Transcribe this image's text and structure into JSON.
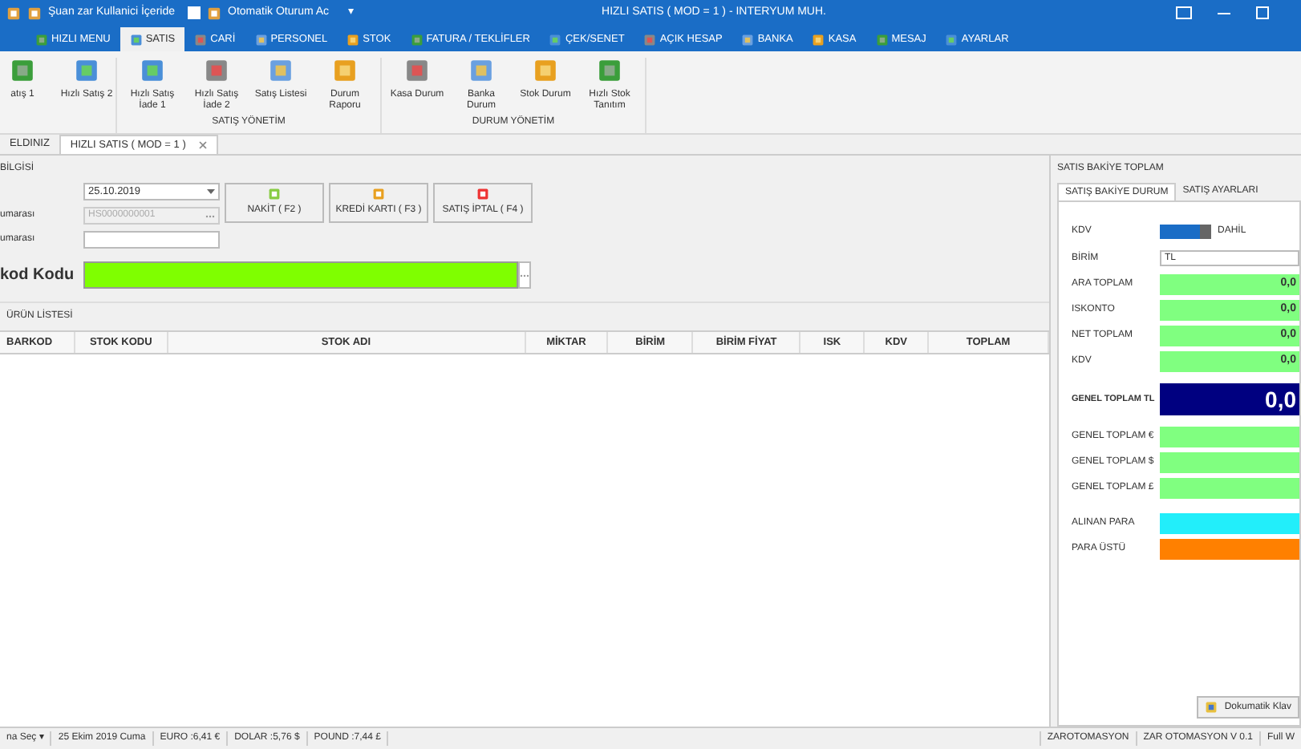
{
  "title_bar": {
    "user": "Şuan zar Kullanici İçeride",
    "auto_login": {
      "label": "Otomatik Oturum Ac",
      "checked": false
    },
    "dropdown": "▾",
    "title": "HIZLI SATIS ( MOD = 1 ) - INTERYUM MUH."
  },
  "menu_tabs": [
    {
      "label": "HIZLI MENU",
      "selected": false
    },
    {
      "label": "SATIS",
      "selected": true
    },
    {
      "label": "CARİ",
      "selected": false
    },
    {
      "label": "PERSONEL",
      "selected": false
    },
    {
      "label": "STOK",
      "selected": false
    },
    {
      "label": "FATURA / TEKLİFLER",
      "selected": false
    },
    {
      "label": "ÇEK/SENET",
      "selected": false
    },
    {
      "label": "AÇIK HESAP",
      "selected": false
    },
    {
      "label": "BANKA",
      "selected": false
    },
    {
      "label": "KASA",
      "selected": false
    },
    {
      "label": "MESAJ",
      "selected": false
    },
    {
      "label": "AYARLAR",
      "selected": false
    }
  ],
  "ribbon": [
    {
      "items": [
        "atış 1",
        "Hızlı Satış 2"
      ]
    },
    {
      "label": "SATIŞ YÖNETİM",
      "items": [
        "Hızlı Satış İade 1",
        "Hızlı Satış İade 2",
        "Satış Listesi",
        "Durum Raporu"
      ]
    },
    {
      "label": "DURUM YÖNETİM",
      "items": [
        "Kasa Durum",
        "Banka Durum",
        "Stok Durum",
        "Hızlı Stok Tanıtım"
      ]
    }
  ],
  "doc_tabs": [
    {
      "label": "ELDINIZ",
      "selected": false,
      "closable": false
    },
    {
      "label": "HIZLI SATIS ( MOD = 1 )",
      "selected": true,
      "closable": true
    }
  ],
  "info": {
    "title": "BİLGİSİ",
    "date": "25.10.2019",
    "number_label": "umarası",
    "number_value": "HS0000000001",
    "number2_label": "umarası",
    "barcode_label": "kod Kodu"
  },
  "actions": [
    "NAKİT  ( F2 )",
    "KREDİ KARTI ( F3 )",
    "SATIŞ İPTAL ( F4 )"
  ],
  "product_list": {
    "title": "ÜRÜN LİSTESİ",
    "columns": [
      "BARKOD",
      "STOK KODU",
      "STOK ADI",
      "MİKTAR",
      "BİRİM",
      "BİRİM FİYAT",
      "ISK",
      "KDV",
      "TOPLAM"
    ]
  },
  "totals": {
    "title": "SATIS BAKİYE TOPLAM",
    "tabs": [
      {
        "label": "SATIŞ BAKİYE DURUM",
        "selected": true
      },
      {
        "label": "SATIŞ AYARLARI",
        "selected": false
      }
    ],
    "kdv": {
      "label": "KDV",
      "on": true,
      "text": "DAHİL"
    },
    "unit": {
      "label": "BİRİM",
      "value": "TL"
    },
    "rows": [
      {
        "kind": "value",
        "label": "ARA TOPLAM",
        "value": "0,0"
      },
      {
        "kind": "value",
        "label": "ISKONTO",
        "value": "0,0"
      },
      {
        "kind": "value",
        "label": "NET TOPLAM",
        "value": "0,0"
      },
      {
        "kind": "value",
        "label": "KDV",
        "value": "0,0"
      },
      {
        "kind": "grand",
        "label": "GENEL TOPLAM TL",
        "value": "0,0"
      },
      {
        "kind": "currency",
        "label": "GENEL TOPLAM €"
      },
      {
        "kind": "currency",
        "label": "GENEL TOPLAM $"
      },
      {
        "kind": "currency",
        "label": "GENEL TOPLAM £"
      },
      {
        "kind": "paid",
        "label": "ALINAN PARA"
      },
      {
        "kind": "change",
        "label": "PARA ÜSTÜ"
      }
    ],
    "keyboard_button": "Dokumatik Klav"
  },
  "status_bar": {
    "left": [
      "na Seç ▾",
      "25 Ekim 2019 Cuma",
      "EURO :6,41 €",
      "DOLAR :5,76 $",
      "POUND :7,44 £"
    ],
    "right": [
      "ZAROTOMASYON",
      "ZAR OTOMASYON V 0.1",
      "Full W"
    ]
  }
}
